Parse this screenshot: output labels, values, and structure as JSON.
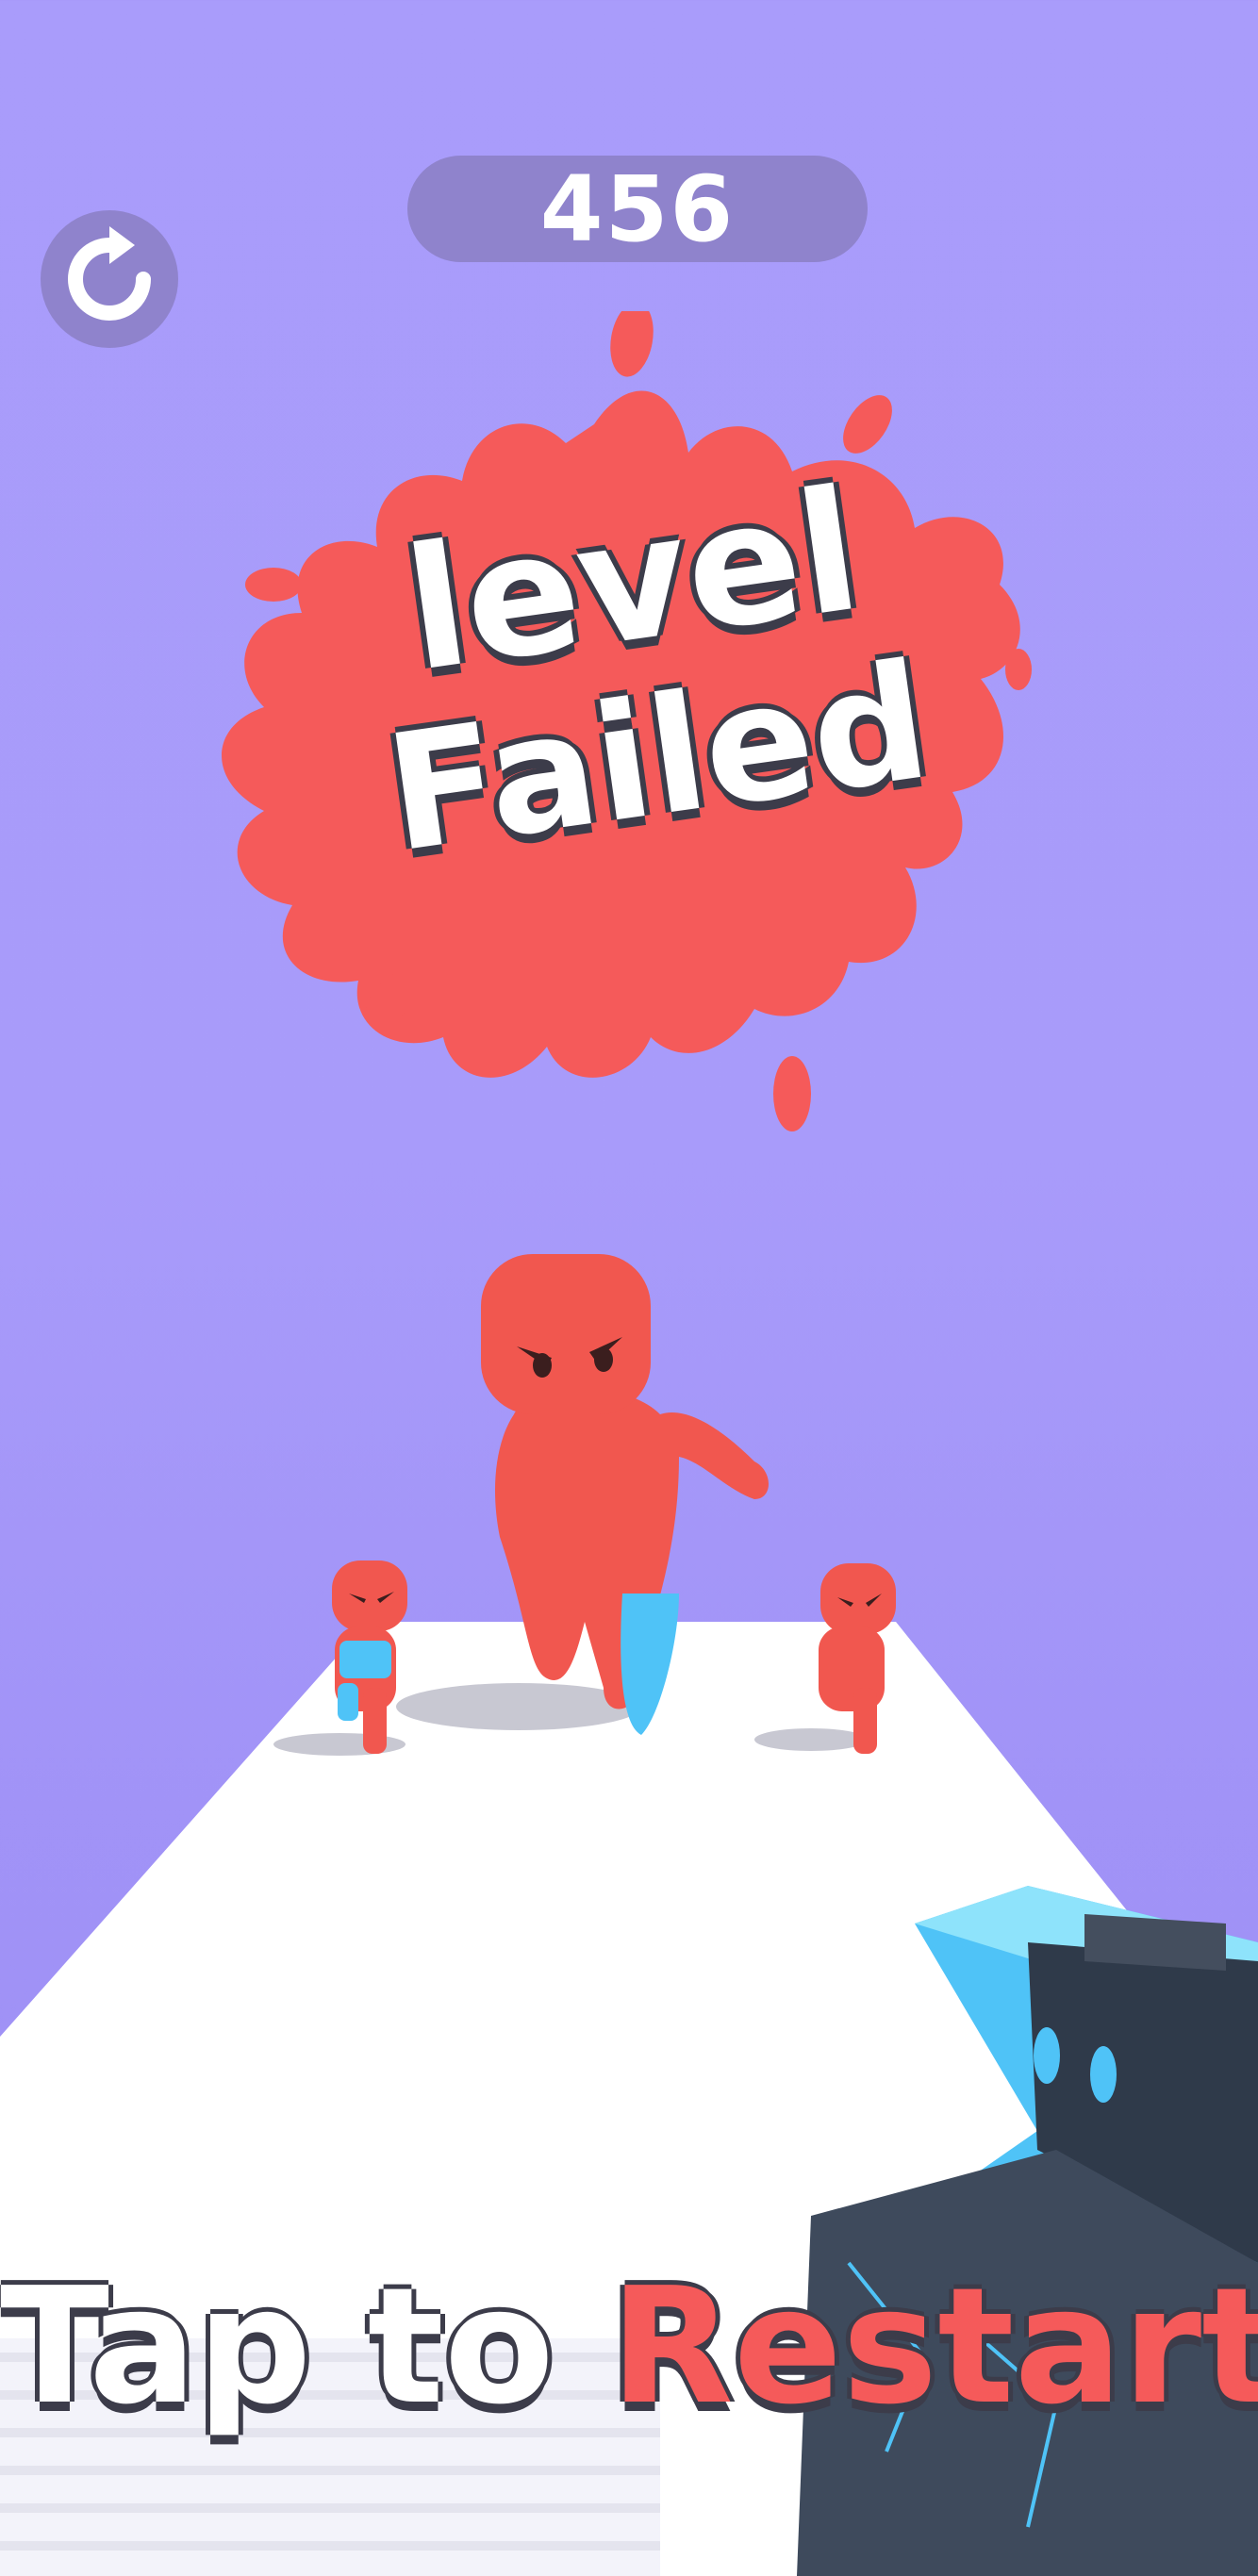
{
  "hud": {
    "score": "456",
    "restart_icon": "refresh-icon"
  },
  "banner": {
    "line1": "level",
    "line2": "Failed"
  },
  "footer": {
    "tap_part": "Tap to",
    "restart_part": "Restart"
  },
  "colors": {
    "sky": "#a99cfb",
    "pill": "#8f83cc",
    "splat": "#f55a5a",
    "enemy": "#f1574f",
    "gun": "#4fc3f7",
    "track": "#ffffff"
  }
}
